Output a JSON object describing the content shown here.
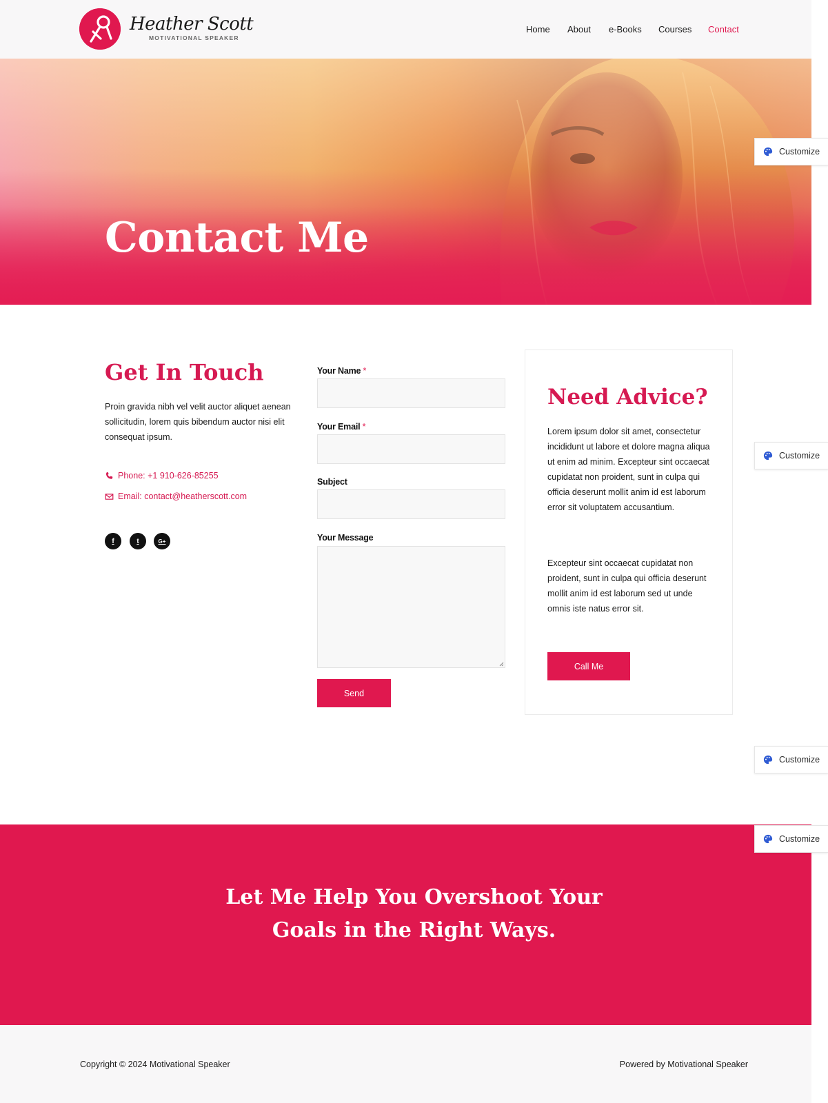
{
  "brand": {
    "name": "Heather Scott",
    "tagline": "MOTIVATIONAL SPEAKER"
  },
  "nav": {
    "items": [
      "Home",
      "About",
      "e-Books",
      "Courses",
      "Contact"
    ],
    "active": "Contact"
  },
  "hero": {
    "title": "Contact Me"
  },
  "customize_label": "Customize",
  "contact": {
    "heading": "Get In Touch",
    "intro": "Proin gravida nibh vel velit auctor aliquet aenean sollicitudin, lorem quis bibendum auctor nisi elit consequat ipsum.",
    "phone": "Phone: +1 910-626-85255",
    "email": "Email: contact@heatherscott.com",
    "social_icons": [
      "facebook-icon",
      "twitter-icon",
      "google-plus-icon"
    ],
    "social_glyphs": [
      "f",
      "t",
      "G+"
    ]
  },
  "form": {
    "name_label": "Your Name",
    "email_label": "Your Email",
    "subject_label": "Subject",
    "message_label": "Your Message",
    "required_mark": "*",
    "name_value": "",
    "email_value": "",
    "subject_value": "",
    "message_value": "",
    "send_label": "Send"
  },
  "advice": {
    "heading": "Need Advice?",
    "paragraph1": "Lorem ipsum dolor sit amet, consectetur incididunt ut labore et dolore magna aliqua ut enim ad minim. Excepteur sint occaecat cupidatat non proident, sunt in culpa qui officia deserunt mollit anim id est laborum error sit voluptatem accusantium.",
    "paragraph2": "Excepteur sint occaecat cupidatat non proident, sunt in culpa qui officia deserunt mollit anim id est laborum sed ut unde omnis iste natus error sit.",
    "button_label": "Call Me"
  },
  "banner": {
    "line1": "Let Me Help You Overshoot Your",
    "line2": "Goals in the Right Ways."
  },
  "footer": {
    "copyright": "Copyright © 2024 Motivational Speaker",
    "powered": "Powered by Motivational Speaker"
  },
  "colors": {
    "accent": "#e0184f",
    "footer_bg": "#f8f7f8",
    "text": "#1a1a1a"
  }
}
